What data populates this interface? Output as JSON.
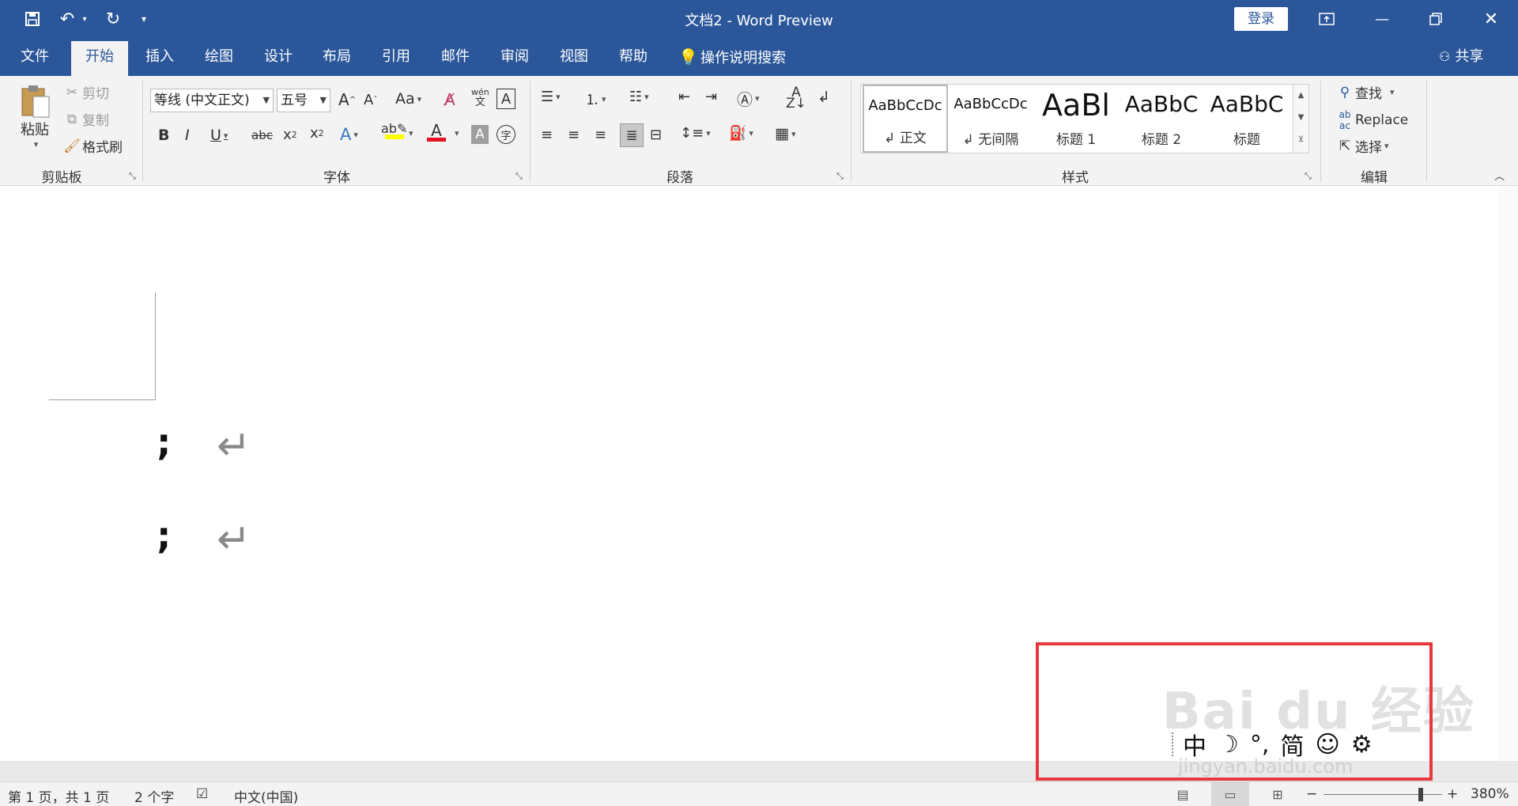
{
  "titlebar": {
    "title": "文档2  -  Word Preview",
    "login": "登录",
    "quick_access": {
      "save": "save-icon",
      "undo": "undo-icon",
      "redo": "redo-icon",
      "customize": "customize-icon"
    }
  },
  "tabs": [
    "文件",
    "开始",
    "插入",
    "绘图",
    "设计",
    "布局",
    "引用",
    "邮件",
    "审阅",
    "视图",
    "帮助"
  ],
  "tell_me": "操作说明搜索",
  "share": "共享",
  "clipboard": {
    "paste": "粘贴",
    "cut": "剪切",
    "copy": "复制",
    "format_painter": "格式刷",
    "group_label": "剪贴板"
  },
  "font": {
    "font_name": "等线 (中文正文)",
    "font_size": "五号",
    "group_label": "字体"
  },
  "paragraph": {
    "group_label": "段落"
  },
  "styles": {
    "group_label": "样式",
    "items": [
      {
        "sample": "AaBbCcDc",
        "name": "↲ 正文"
      },
      {
        "sample": "AaBbCcDc",
        "name": "↲ 无间隔"
      },
      {
        "sample": "AaBl",
        "name": "标题 1"
      },
      {
        "sample": "AaBbC",
        "name": "标题 2"
      },
      {
        "sample": "AaBbC",
        "name": "标题"
      }
    ]
  },
  "editing": {
    "find": "查找",
    "replace": "Replace",
    "select": "选择",
    "group_label": "编辑"
  },
  "document": {
    "lines": [
      ";",
      ";"
    ]
  },
  "ime": {
    "mode": "中",
    "moon": "☽",
    "punct": "°,",
    "simplified": "简",
    "emoji": "☺",
    "settings": "⚙"
  },
  "watermark": {
    "main": "Bai du 经验",
    "sub": "jingyan.baidu.com"
  },
  "status": {
    "page": "第 1 页，共 1 页",
    "words": "2 个字",
    "language": "中文(中国)",
    "zoom": "380%",
    "zoom_level": 0.82
  },
  "colors": {
    "brand": "#2b579a",
    "highlight_box": "#e8383d",
    "highlight_yellow": "#ffff00",
    "font_red": "#e81123"
  }
}
